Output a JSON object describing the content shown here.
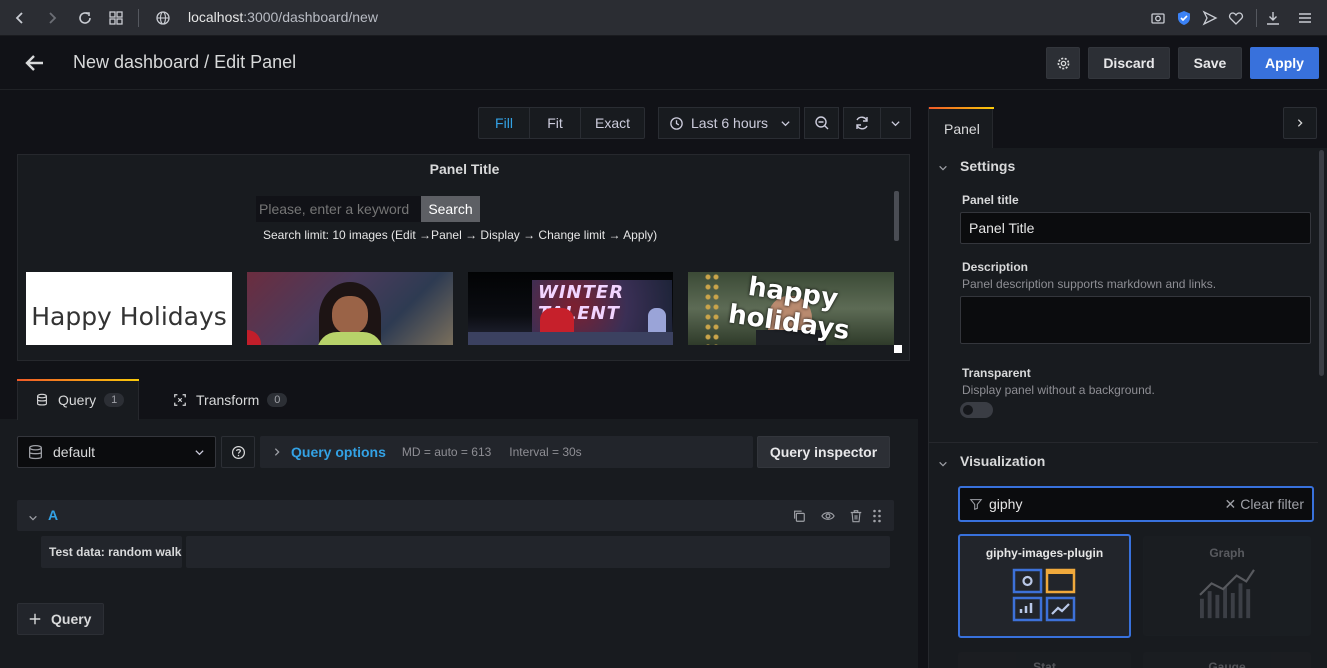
{
  "browser": {
    "url_host": "localhost",
    "url_path": ":3000/dashboard/new"
  },
  "header": {
    "title": "New dashboard / Edit Panel",
    "discard_label": "Discard",
    "save_label": "Save",
    "apply_label": "Apply"
  },
  "toolbar": {
    "view_modes": [
      "Fill",
      "Fit",
      "Exact"
    ],
    "active_mode": "Fill",
    "time_range": "Last 6 hours"
  },
  "panel": {
    "title": "Panel Title",
    "search_placeholder": "Please, enter a keyword",
    "search_button": "Search",
    "search_limit_text": "Search limit: 10 images (Edit →Panel → Display → Change limit → Apply)",
    "images": [
      {
        "caption": "Happy Holidays"
      },
      {
        "caption": ""
      },
      {
        "caption": "WINTER TALENT"
      },
      {
        "caption": "happy holidays"
      }
    ]
  },
  "query_tabs": {
    "query_label": "Query",
    "query_count": "1",
    "transform_label": "Transform",
    "transform_count": "0"
  },
  "query_row": {
    "datasource": "default",
    "options_label": "Query options",
    "md_text": "MD = auto = 613",
    "interval_text": "Interval = 30s",
    "inspector_label": "Query inspector"
  },
  "query_a": {
    "ref": "A",
    "scenario_label": "Test data: random walk",
    "add_query_label": "Query"
  },
  "side": {
    "tab_label": "Panel",
    "settings_heading": "Settings",
    "panel_title_label": "Panel title",
    "panel_title_value": "Panel Title",
    "description_label": "Description",
    "description_hint": "Panel description supports markdown and links.",
    "transparent_label": "Transparent",
    "transparent_hint": "Display panel without a background.",
    "viz_heading": "Visualization",
    "filter_value": "giphy",
    "clear_filter": "Clear filter",
    "viz_cards": [
      "giphy-images-plugin",
      "Graph",
      "Stat",
      "Gauge"
    ]
  }
}
